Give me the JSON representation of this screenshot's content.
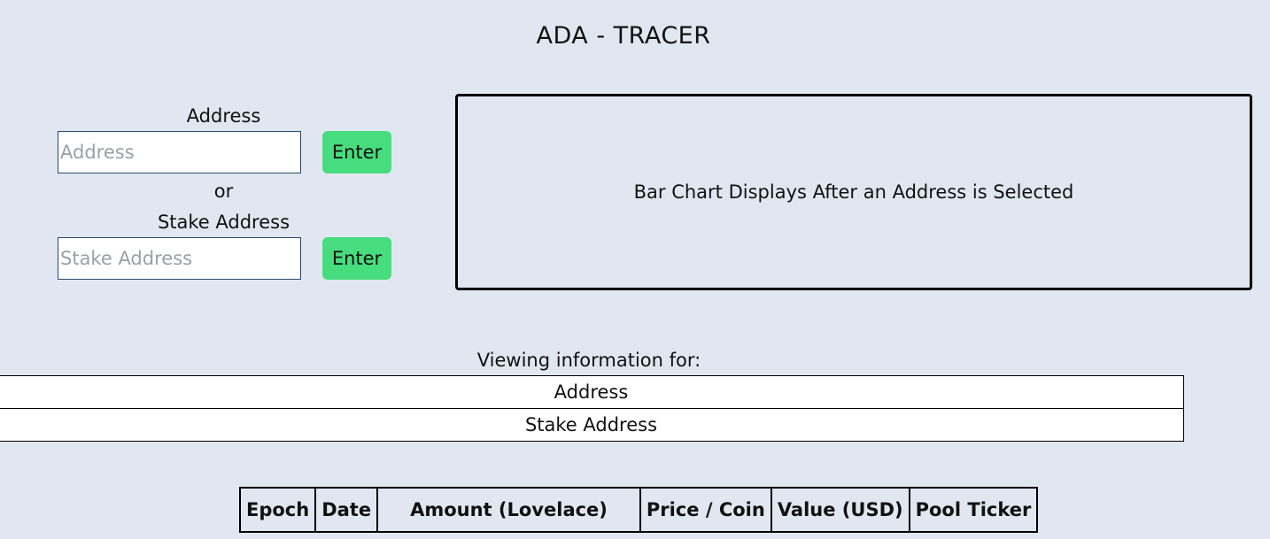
{
  "header": {
    "title": "ADA - TRACER"
  },
  "address_form": {
    "label": "Address",
    "placeholder": "Address",
    "value": "",
    "enter_label": "Enter"
  },
  "separator": "or",
  "stake_form": {
    "label": "Stake Address",
    "placeholder": "Stake Address",
    "value": "",
    "enter_label": "Enter"
  },
  "chart_panel": {
    "message": "Bar Chart Displays After an Address is Selected"
  },
  "viewing": {
    "label": "Viewing information for:",
    "address": "Address",
    "stake_address": "Stake Address"
  },
  "rewards_table": {
    "columns": [
      "Epoch",
      "Date",
      "Amount (Lovelace)",
      "Price / Coin",
      "Value (USD)",
      "Pool Ticker"
    ],
    "rows": []
  },
  "colors": {
    "background": "#e0e7f0",
    "button": "#47dc7d",
    "input_border": "#2b4a6a"
  }
}
